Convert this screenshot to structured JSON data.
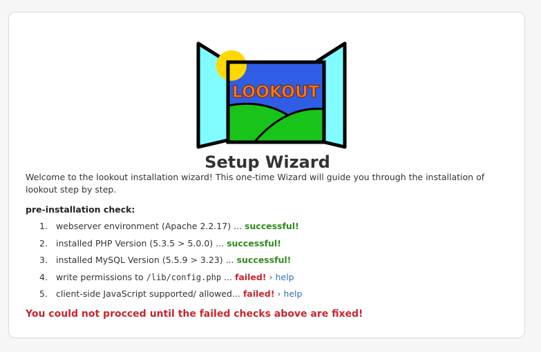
{
  "logo": {
    "text": "LOOKOUT"
  },
  "page": {
    "title": "Setup Wizard"
  },
  "intro": {
    "text": "Welcome to the lookout installation wizard! This one-time Wizard will guide you through the installation of lookout step by step."
  },
  "checks": {
    "title": "pre-installation check:",
    "items": [
      {
        "num": "1.",
        "text": "webserver environment (Apache 2.2.17) ...",
        "status": "successful!"
      },
      {
        "num": "2.",
        "text": "installed PHP Version (5.3.5 > 5.0.0) ...",
        "status": "successful!"
      },
      {
        "num": "3.",
        "text": "installed MySQL Version (5.5.9 > 3.23) ...",
        "status": "successful!"
      },
      {
        "num": "4.",
        "text_before": "write permissions to",
        "code": "/lib/config.php",
        "text_after": "...",
        "status": "failed!",
        "link": "help"
      },
      {
        "num": "5.",
        "text": "client-side JavaScript supported/ allowed...",
        "status": "failed!",
        "link": "help"
      }
    ],
    "arrow": "›"
  },
  "error": {
    "text": "You could not procced until the failed checks above are fixed!"
  },
  "colors": {
    "success": "#2f8a1a",
    "failure": "#c8262e",
    "link": "#2f6fb0"
  }
}
